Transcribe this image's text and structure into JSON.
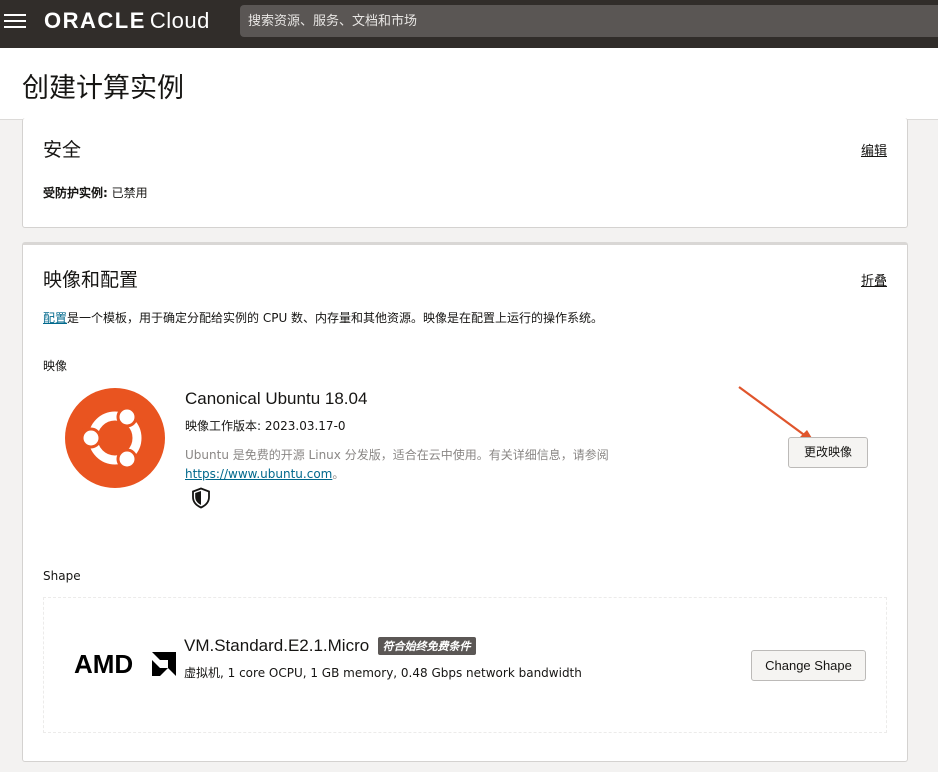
{
  "topbar": {
    "logo_oracle": "ORACLE",
    "logo_cloud": "Cloud",
    "search_placeholder": "搜索资源、服务、文档和市场"
  },
  "page": {
    "title": "创建计算实例"
  },
  "security": {
    "title": "安全",
    "edit_label": "编辑",
    "shielded_label": "受防护实例:",
    "shielded_value": "已禁用"
  },
  "image_section": {
    "title": "映像和配置",
    "collapse_label": "折叠",
    "desc_link": "配置",
    "desc_text": "是一个模板，用于确定分配给实例的 CPU 数、内存量和其他资源。映像是在配置上运行的操作系统。",
    "image_label": "映像",
    "image": {
      "name": "Canonical Ubuntu 18.04",
      "build": "映像工作版本: 2023.03.17-0",
      "desc": "Ubuntu 是免费的开源 Linux 分发版，适合在云中使用。有关详细信息，请参阅",
      "link": "https://www.ubuntu.com",
      "link_suffix": "。",
      "change_button": "更改映像",
      "icon": "shield-icon"
    },
    "shape_label": "Shape",
    "shape": {
      "name": "VM.Standard.E2.1.Micro",
      "badge": "符合始终免费条件",
      "spec": "虚拟机, 1 core OCPU, 1 GB memory, 0.48 Gbps network bandwidth",
      "change_button": "Change Shape",
      "vendor_logo": "AMD"
    }
  },
  "colors": {
    "topbar": "#312d2a",
    "ubuntu_orange": "#e95420",
    "link": "#00688c",
    "annotation_arrow": "#e0552c"
  }
}
